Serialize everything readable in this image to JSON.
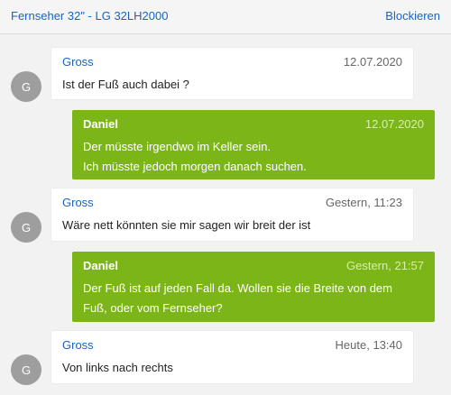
{
  "header": {
    "title": "Fernseher 32\" - LG 32LH2000",
    "block_label": "Blockieren"
  },
  "messages": [
    {
      "sender": "Gross",
      "time": "12.07.2020",
      "avatar": "G",
      "lines": [
        "Ist der Fuß auch dabei ?"
      ]
    },
    {
      "sender": "Daniel",
      "time": "12.07.2020",
      "lines": [
        "Der müsste irgendwo im Keller sein.",
        "Ich müsste jedoch morgen danach suchen."
      ]
    },
    {
      "sender": "Gross",
      "time": "Gestern, 11:23",
      "avatar": "G",
      "lines": [
        "Wäre nett könnten sie mir sagen wir breit der ist"
      ]
    },
    {
      "sender": "Daniel",
      "time": "Gestern, 21:57",
      "lines": [
        "Der Fuß ist auf jeden Fall da. Wollen sie die Breite von dem",
        "Fuß, oder vom Fernseher?"
      ]
    },
    {
      "sender": "Gross",
      "time": "Heute, 13:40",
      "avatar": "G",
      "lines": [
        "Von links nach rechts"
      ]
    }
  ],
  "colors": {
    "link": "#1a63c0",
    "outgoing_bubble": "#7cb518",
    "avatar": "#9e9e9e"
  }
}
